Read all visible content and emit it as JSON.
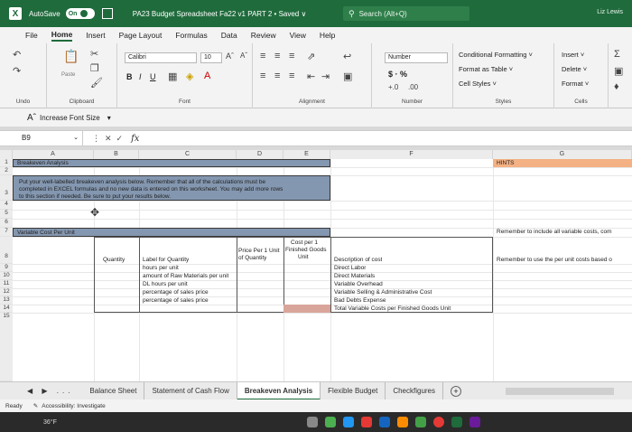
{
  "titlebar": {
    "autosave_label": "AutoSave",
    "autosave_state": "On",
    "doc_title": "PA23 Budget Spreadsheet Fa22 v1 PART 2 • Saved ∨",
    "search_placeholder": "Search (Alt+Q)",
    "user": "Liz Lewis"
  },
  "menu": {
    "tabs": [
      "File",
      "Home",
      "Insert",
      "Page Layout",
      "Formulas",
      "Data",
      "Review",
      "View",
      "Help"
    ],
    "active": "Home"
  },
  "ribbon": {
    "groups": {
      "undo": "Undo",
      "clipboard": "Clipboard",
      "font": "Font",
      "alignment": "Alignment",
      "number": "Number",
      "styles": "Styles",
      "cells": "Cells"
    },
    "paste_label": "Paste",
    "font_name": "Calibri",
    "font_size": "10",
    "number_format": "Number",
    "conditional_formatting": "Conditional Formatting ˅",
    "format_as_table": "Format as Table ˅",
    "cell_styles": "Cell Styles ˅",
    "insert": "Insert ˅",
    "delete": "Delete ˅",
    "format": "Format ˅",
    "bold": "B",
    "italic": "I",
    "underline": "U",
    "dollar": "$ · %",
    "comma": "                            "
  },
  "strip": {
    "increase_font_label": "Increase Font Size"
  },
  "formula_bar": {
    "cell_ref": "B9",
    "fx": "fx"
  },
  "columns": [
    "A",
    "B",
    "C",
    "D",
    "E",
    "F",
    "G"
  ],
  "rows": [
    "1",
    "2",
    "3",
    "4",
    "5",
    "6",
    "7",
    "8",
    "9",
    "10",
    "11",
    "12",
    "13",
    "14",
    "15"
  ],
  "sheet": {
    "title": "Breakeven Analysis",
    "instructions_1": "Put your well-labelled breakeven analysis below. Remember that all of the calculations must be",
    "instructions_2": "completed in EXCEL formulas and no new data is entered on this worksheet. You may add more rows",
    "instructions_3": "to this section if needed. Be sure to put your results below.",
    "section_variable": "Variable Cost Per Unit",
    "hdr_quantity": "Quantity",
    "hdr_label": "Label for Quantity",
    "hdr_price_1": "Price Per 1 Unit",
    "hdr_price_2": "of Quantity",
    "hdr_cost_1": "Cost per 1",
    "hdr_cost_2": "Finished Goods",
    "hdr_cost_3": "Unit",
    "hdr_desc": "Description of cost",
    "labels": [
      "hours per unit",
      "amount of Raw Materials per unit",
      "DL hours per unit",
      "percentage of sales price",
      "percentage of sales price"
    ],
    "descriptions": [
      "Direct Labor",
      "Direct Materials",
      "Variable Overhead",
      "Variable Selling & Administrative Cost",
      "Bad Debts Expense",
      "Total Variable Costs per Finished Goods Unit"
    ],
    "hints": "HINTS",
    "hint_1": "Remember to include all variable costs, com",
    "hint_2": "Remember to use the per unit costs based o"
  },
  "sheet_tabs": [
    "Balance Sheet",
    "Statement of Cash Flow",
    "Breakeven Analysis",
    "Flexible Budget",
    "Checkfigures"
  ],
  "active_sheet": "Breakeven Analysis",
  "status": {
    "ready": "Ready",
    "accessibility": "Accessibility: Investigate"
  },
  "taskbar": {
    "temperature": "36°F"
  },
  "colors": {
    "excel_green": "#1f6b3c",
    "band": "#8497b0",
    "hints": "#f4b183",
    "total_cell": "#d9a59a"
  }
}
